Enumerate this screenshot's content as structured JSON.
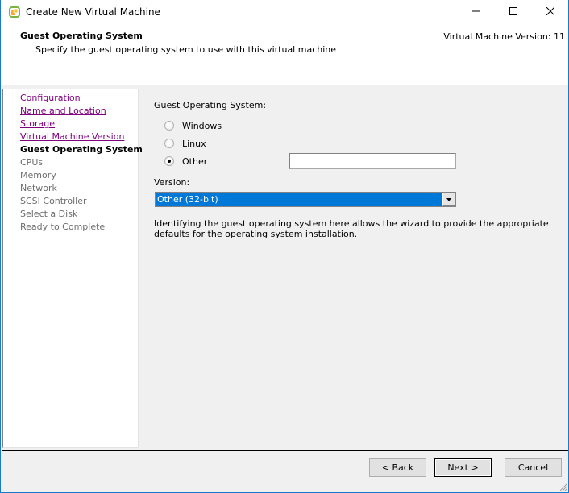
{
  "window": {
    "title": "Create New Virtual Machine",
    "app_icon": "vsphere-logo-icon",
    "controls": {
      "minimize": "minimize-icon",
      "maximize": "maximize-icon",
      "close": "close-icon"
    },
    "accent_color": "#1979ca"
  },
  "header": {
    "title": "Guest Operating System",
    "subtitle": "Specify the guest operating system to use with this virtual machine",
    "version_label": "Virtual Machine Version: 11"
  },
  "sidebar": {
    "steps": [
      {
        "label": "Configuration",
        "state": "done"
      },
      {
        "label": "Name and Location",
        "state": "done"
      },
      {
        "label": "Storage",
        "state": "done"
      },
      {
        "label": "Virtual Machine Version",
        "state": "done"
      },
      {
        "label": "Guest Operating System",
        "state": "current"
      },
      {
        "label": "CPUs",
        "state": "pending"
      },
      {
        "label": "Memory",
        "state": "pending"
      },
      {
        "label": "Network",
        "state": "pending"
      },
      {
        "label": "SCSI Controller",
        "state": "pending"
      },
      {
        "label": "Select a Disk",
        "state": "pending"
      },
      {
        "label": "Ready to Complete",
        "state": "pending"
      }
    ]
  },
  "main": {
    "guest_os_label": "Guest Operating System:",
    "os_options": [
      {
        "label": "Windows",
        "checked": false
      },
      {
        "label": "Linux",
        "checked": false
      },
      {
        "label": "Other",
        "checked": true
      }
    ],
    "other_input": {
      "value": "",
      "placeholder": ""
    },
    "version_label": "Version:",
    "version_select": {
      "value": "Other (32-bit)",
      "highlight_color": "#0078d7"
    },
    "description": "Identifying the guest operating system here allows the wizard to provide the appropriate defaults for the operating system installation."
  },
  "footer": {
    "back_label": "< Back",
    "next_label": "Next >",
    "cancel_label": "Cancel"
  }
}
